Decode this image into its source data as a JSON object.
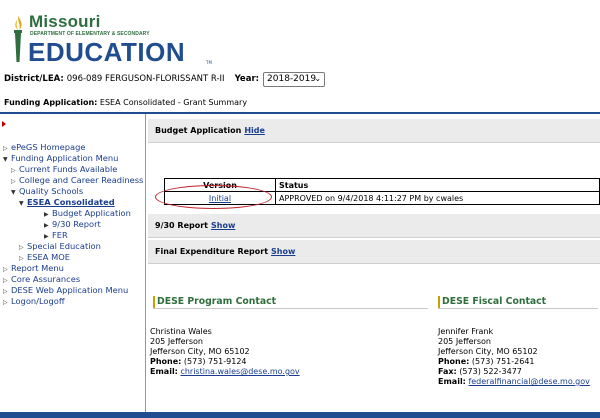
{
  "logo": {
    "missouri": "Missouri",
    "dept": "DEPARTMENT OF ELEMENTARY & SECONDARY",
    "education": "EDUCATION",
    "tm": "TM"
  },
  "district": {
    "label": "District/LEA:",
    "value": "096-089 FERGUSON-FLORISSANT R-II",
    "year_label": "Year:",
    "year_value": "2018-2019"
  },
  "funding": {
    "label": "Funding Application:",
    "value": "ESEA Consolidated - Grant Summary"
  },
  "sidebar": {
    "items": [
      {
        "label": "ePeGS Homepage"
      },
      {
        "label": "Funding Application Menu"
      },
      {
        "label": "Current Funds Available"
      },
      {
        "label": "College and Career Readiness"
      },
      {
        "label": "Quality Schools"
      },
      {
        "label": "ESEA Consolidated"
      },
      {
        "label": "Budget Application"
      },
      {
        "label": "9/30 Report"
      },
      {
        "label": "FER"
      },
      {
        "label": "Special Education"
      },
      {
        "label": "ESEA MOE"
      },
      {
        "label": "Report Menu"
      },
      {
        "label": "Core Assurances"
      },
      {
        "label": "DESE Web Application Menu"
      },
      {
        "label": "Logon/Logoff"
      }
    ]
  },
  "budget": {
    "title": "Budget Application",
    "toggle": "Hide",
    "table": {
      "headers": [
        "Version",
        "Status"
      ],
      "rows": [
        {
          "version": "Initial",
          "status": "APPROVED on 9/4/2018 4:11:27 PM by cwales"
        }
      ]
    }
  },
  "report930": {
    "title": "9/30 Report",
    "toggle": "Show"
  },
  "fer": {
    "title": "Final Expenditure Report",
    "toggle": "Show"
  },
  "program_contact": {
    "title": "DESE Program Contact",
    "name": "Christina Wales",
    "address1": "205 Jefferson",
    "address2": "Jefferson City, MO 65102",
    "phone_label": "Phone:",
    "phone": "(573) 751-9124",
    "email_label": "Email:",
    "email": "christina.wales@dese.mo.gov"
  },
  "fiscal_contact": {
    "title": "DESE Fiscal Contact",
    "name": "Jennifer Frank",
    "address1": "205 Jefferson",
    "address2": "Jefferson City, MO 65102",
    "phone_label": "Phone:",
    "phone": "(573) 751-2641",
    "fax_label": "Fax:",
    "fax": "(573) 522-3477",
    "email_label": "Email:",
    "email": "federalfinancial@dese.mo.gov"
  },
  "colors": {
    "brand_blue": "#1f4d8f",
    "brand_green": "#2e6e3e",
    "link": "#1a3d8f",
    "highlight_ring": "#c0222a"
  }
}
